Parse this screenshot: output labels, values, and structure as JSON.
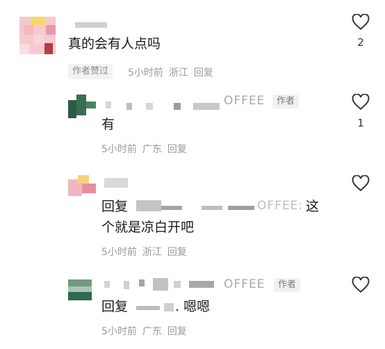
{
  "comments": [
    {
      "text": "真的会有人点吗",
      "author_badge": "作者赞过",
      "time": "5小时前",
      "location": "浙江",
      "reply": "回复",
      "likes": "2"
    },
    {
      "handle_suffix": "OFFEE",
      "author_tag": "作者",
      "text": "有",
      "time": "5小时前",
      "location": "广东",
      "reply": "回复",
      "likes": "1"
    },
    {
      "text_prefix": "回复",
      "handle_suffix": "OFFEE:",
      "text_suffix": "这",
      "text_line2": "个就是凉白开吧",
      "time": "5小时前",
      "location": "浙江",
      "reply": "回复"
    },
    {
      "handle_suffix": "OFFEE",
      "author_tag": "作者",
      "text_prefix": "回复",
      "text_suffix": ". 嗯嗯",
      "time": "5小时前",
      "location": "广东",
      "reply": "回复"
    }
  ],
  "icons": {
    "like": "heart-outline-icon"
  }
}
